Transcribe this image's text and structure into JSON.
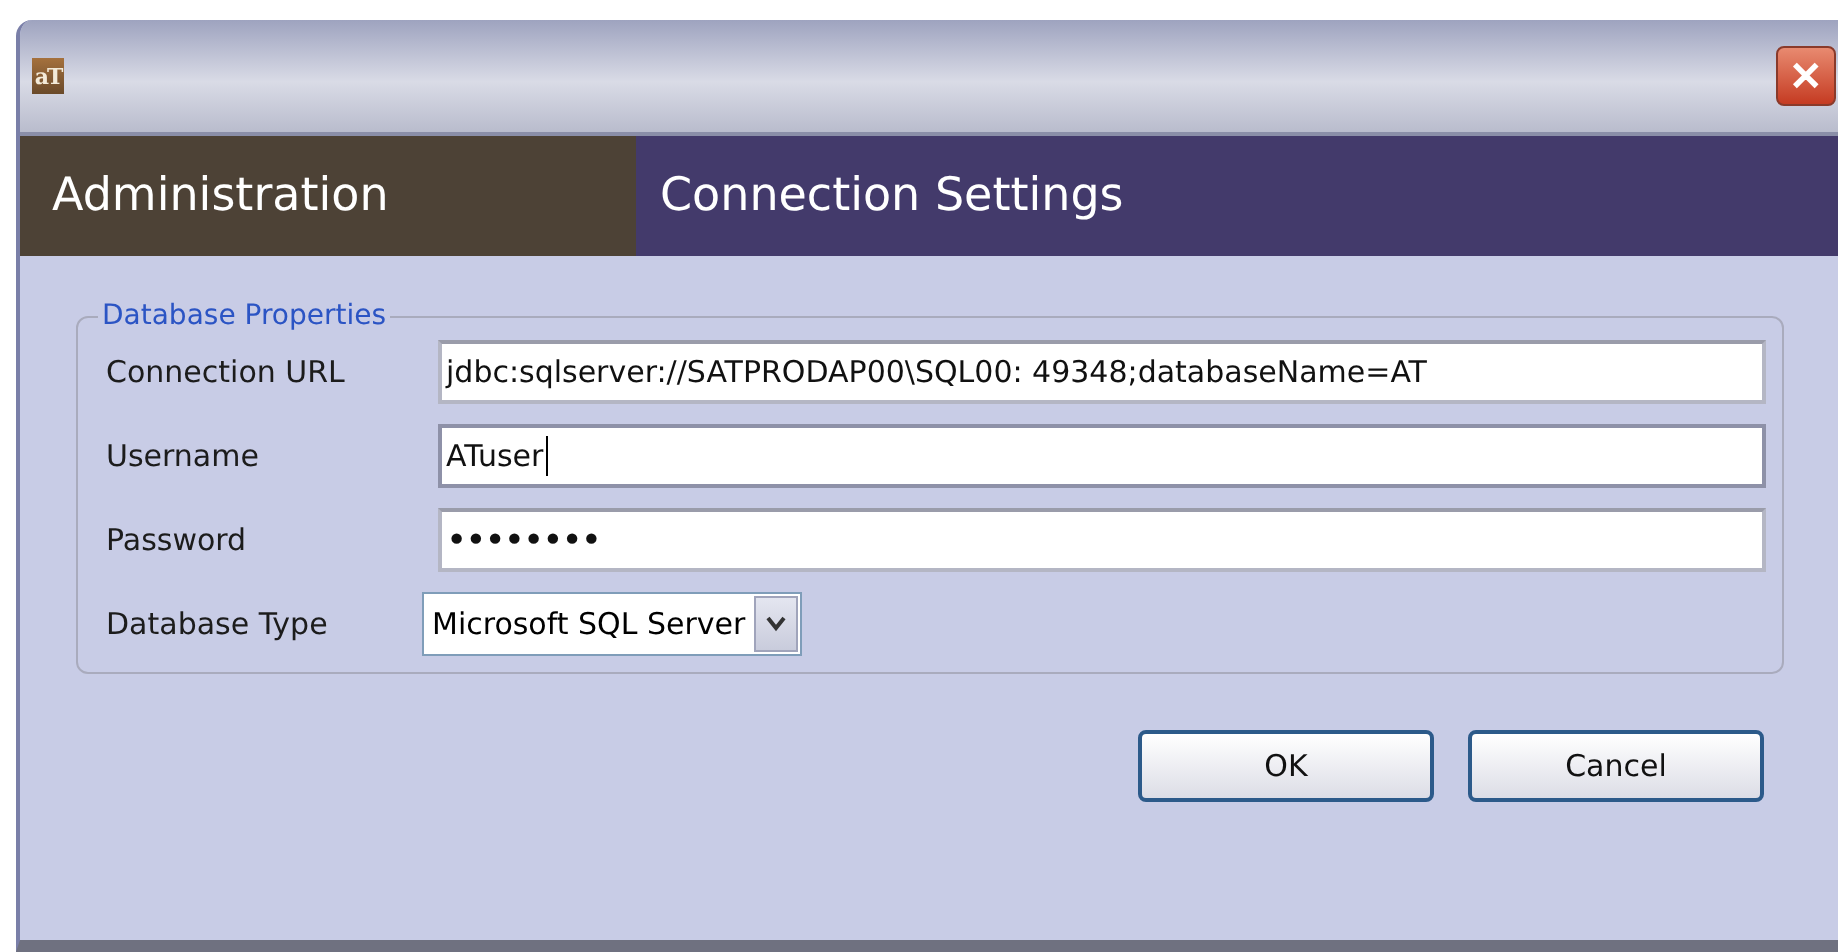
{
  "window": {
    "icon_text": "aT",
    "close": "✕"
  },
  "header": [
    {
      "label": "Administration",
      "selected": false
    },
    {
      "label": "Connection Settings",
      "selected": true
    }
  ],
  "group": {
    "title": "Database Properties"
  },
  "fields": [
    {
      "kind": "text",
      "label": "Connection URL",
      "value": "jdbc:sqlserver://SATPRODAP00\\SQL00: 49348;databaseName=AT",
      "focused": false
    },
    {
      "kind": "text",
      "label": "Username",
      "value": "ATuser",
      "focused": true
    },
    {
      "kind": "password",
      "label": "Password",
      "value": "••••••••",
      "focused": false
    },
    {
      "kind": "select",
      "label": "Database Type",
      "value": "Microsoft SQL Server",
      "focused": false
    }
  ],
  "buttons": [
    "OK",
    "Cancel"
  ]
}
